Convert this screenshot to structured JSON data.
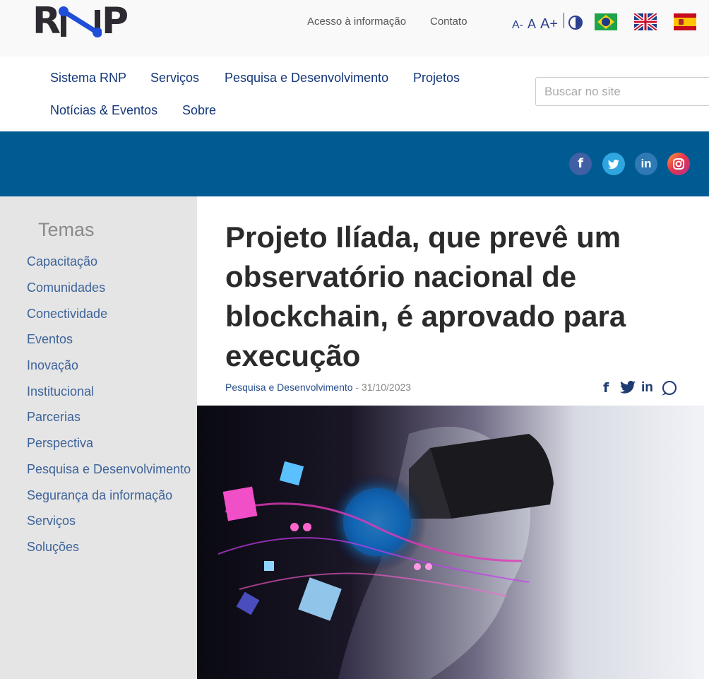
{
  "brand": {
    "logo_text": "RNP"
  },
  "top_links": {
    "access_info": "Acesso à informação",
    "contact": "Contato"
  },
  "font_controls": {
    "decrease": "A-",
    "normal": "A",
    "increase": "A+"
  },
  "icons": {
    "contrast": "contrast-icon",
    "flags": [
      "flag-brazil-icon",
      "flag-uk-icon",
      "flag-spain-icon"
    ],
    "social": [
      "facebook-icon",
      "twitter-icon",
      "linkedin-icon",
      "instagram-icon"
    ],
    "share": [
      "facebook-share-icon",
      "twitter-share-icon",
      "linkedin-share-icon",
      "whatsapp-share-icon"
    ]
  },
  "nav": {
    "items": [
      "Sistema RNP",
      "Serviços",
      "Pesquisa e Desenvolvimento",
      "Projetos",
      "Notícias & Eventos",
      "Sobre"
    ],
    "search_placeholder": "Buscar no site"
  },
  "social_labels": {
    "facebook": "f",
    "twitter": "🐦",
    "linkedin": "in",
    "instagram": "◎"
  },
  "sidebar": {
    "title": "Temas",
    "topics": [
      "Capacitação",
      "Comunidades",
      "Conectividade",
      "Eventos",
      "Inovação",
      "Institucional",
      "Parcerias",
      "Perspectiva",
      "Pesquisa e Desenvolvimento",
      "Segurança da informação",
      "Serviços",
      "Soluções"
    ]
  },
  "article": {
    "title": "Projeto Ilíada, que prevê um observatório nacional de blockchain, é aprovado para execução",
    "category": "Pesquisa e Desenvolvimento",
    "date": "31/10/2023",
    "date_prefix": " - "
  },
  "share_labels": {
    "facebook": "f",
    "twitter": "🐦",
    "linkedin": "in"
  },
  "colors": {
    "brand_navy": "#14377a",
    "band_blue": "#005b92",
    "sidebar_bg": "#e5e5e5",
    "accent_blue": "#1f4fd8"
  }
}
